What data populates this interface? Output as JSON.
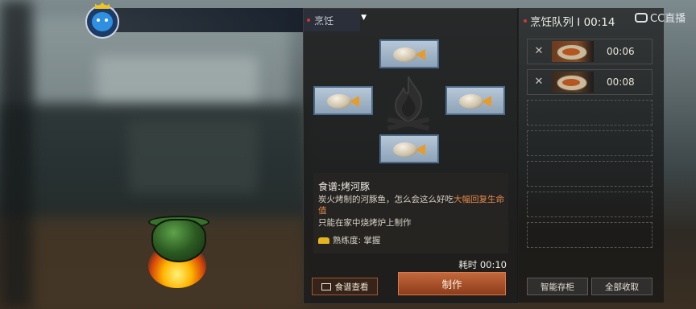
{
  "header": {
    "avatar_icon": "player-avatar"
  },
  "cooking": {
    "tab_label": "烹饪",
    "ingredients": [
      {
        "name": "puffer-fish",
        "icon": "puffer-fish-icon"
      },
      {
        "name": "puffer-fish",
        "icon": "puffer-fish-icon"
      },
      {
        "name": "puffer-fish",
        "icon": "puffer-fish-icon"
      },
      {
        "name": "puffer-fish",
        "icon": "puffer-fish-icon"
      }
    ],
    "recipe": {
      "title": "食谱:烤河豚",
      "desc_normal": "炭火烤制的河豚鱼，怎么会这么好吃",
      "desc_highlight": "大幅回复生命值",
      "note": "只能在家中烧烤炉上制作",
      "skill": "熟练度: 掌握"
    },
    "time_cost": "耗时 00:10",
    "recipe_book_button": "食谱查看",
    "make_button": "制作"
  },
  "queue": {
    "title": "烹饪队列 I 00:14",
    "items": [
      {
        "time": "00:06"
      },
      {
        "time": "00:08"
      }
    ],
    "empty_slots": 5,
    "smart_storage_button": "智能存柜",
    "collect_all_button": "全部收取"
  },
  "watermark": {
    "text": "CC直播"
  },
  "colors": {
    "accent": "#c2683c",
    "highlight": "#e48a4a",
    "alert_dot": "#d5362f"
  }
}
